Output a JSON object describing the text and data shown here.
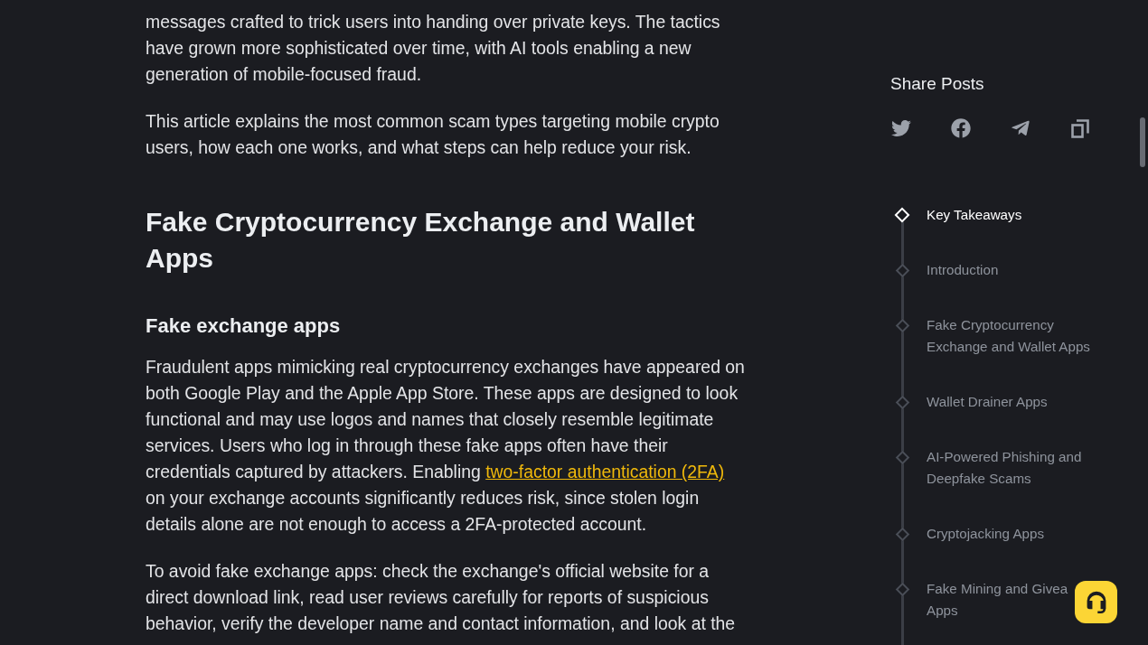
{
  "article": {
    "blocks": [
      {
        "kind": "paragraph",
        "segments": [
          {
            "kind": "text",
            "text": "messages crafted to trick users into handing over private keys. The tactics have grown more sophisticated over time, with AI tools enabling a new generation of mobile-focused fraud."
          }
        ]
      },
      {
        "kind": "paragraph",
        "segments": [
          {
            "kind": "text",
            "text": "This article explains the most common scam types targeting mobile crypto users, how each one works, and what steps can help reduce your risk."
          }
        ]
      },
      {
        "kind": "heading",
        "segments": [
          {
            "kind": "text",
            "text": "Fake Cryptocurrency Exchange and Wallet Apps"
          }
        ]
      },
      {
        "kind": "subheading",
        "segments": [
          {
            "kind": "text",
            "text": "Fake exchange apps"
          }
        ]
      },
      {
        "kind": "paragraph",
        "segments": [
          {
            "kind": "text",
            "text": "Fraudulent apps mimicking real cryptocurrency exchanges have appeared on both Google Play and the Apple App Store. These apps are designed to look functional and may use logos and names that closely resemble legitimate services. Users who log in through these fake apps often have their credentials captured by attackers. Enabling "
          },
          {
            "kind": "link",
            "text": "two-factor authentication (2FA)"
          },
          {
            "kind": "text",
            "text": " on your exchange accounts significantly reduces risk, since stolen login details alone are not enough to access a 2FA-protected account."
          }
        ]
      },
      {
        "kind": "paragraph",
        "segments": [
          {
            "kind": "text",
            "text": "To avoid fake exchange apps: check the exchange's official website for a direct download link, read user reviews carefully for reports of suspicious behavior, verify the developer name and contact information, and look at the"
          }
        ]
      }
    ]
  },
  "sidebar": {
    "share": {
      "title": "Share Posts"
    },
    "toc": {
      "items": [
        {
          "lines": [
            "Key Takeaways"
          ],
          "selected": true
        },
        {
          "lines": [
            "Introduction"
          ],
          "selected": false
        },
        {
          "lines": [
            "Fake Cryptocurrency",
            "Exchange and Wallet Apps"
          ],
          "selected": false
        },
        {
          "lines": [
            "Wallet Drainer Apps"
          ],
          "selected": false
        },
        {
          "lines": [
            "AI-Powered Phishing and",
            "Deepfake Scams"
          ],
          "selected": false
        },
        {
          "lines": [
            "Cryptojacking Apps"
          ],
          "selected": false
        },
        {
          "lines": [
            "Fake Mining and Givea",
            "Apps"
          ],
          "selected": false
        }
      ]
    }
  }
}
